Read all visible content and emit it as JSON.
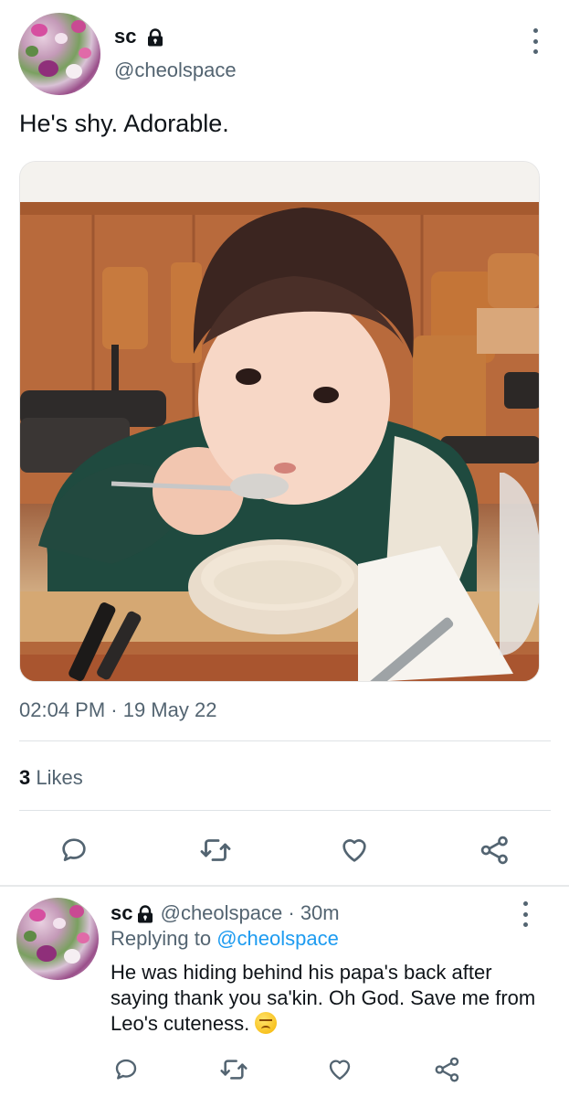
{
  "tweet": {
    "display_name": "sc",
    "handle": "@cheolspace",
    "text": "He's shy. Adorable.",
    "timestamp": "02:04 PM · 19 May 22",
    "likes_count": "3",
    "likes_label": "Likes",
    "media_description_icon": "photo-boy-eating-soup"
  },
  "reply": {
    "display_name": "sc",
    "handle": "@cheolspace",
    "time": "· 30m",
    "replying_label": "Replying to",
    "replying_mention": "@cheolspace",
    "text": "He was hiding behind his papa's back after saying thank you sa'kin. Oh God. Save me from Leo's cuteness."
  },
  "icons": {
    "lock": "lock-icon",
    "more": "more-icon",
    "reply": "reply-icon",
    "retweet": "retweet-icon",
    "like": "heart-icon",
    "share": "share-icon",
    "emoji": "persevering-face-emoji"
  },
  "colors": {
    "text_primary": "#0f1419",
    "text_secondary": "#536471",
    "link": "#1d9bf0",
    "divider": "#dfe3e6"
  }
}
